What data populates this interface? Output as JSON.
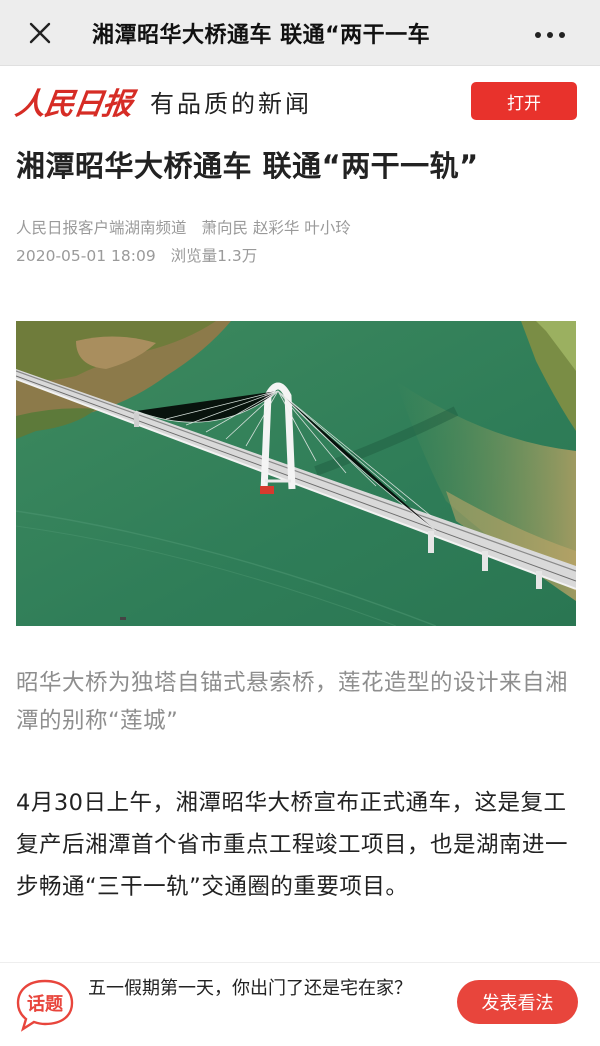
{
  "topbar": {
    "title": "湘潭昭华大桥通车 联通“两干一车",
    "close_icon": "close-icon",
    "more_icon": "more-dots-icon"
  },
  "brand": {
    "logo_text": "人民日报",
    "slogan": "有品质的新闻",
    "open_label": "打开",
    "accent_color": "#e8322c"
  },
  "article": {
    "headline": "湘潭昭华大桥通车 联通“两干一轨”",
    "source": "人民日报客户端湖南频道",
    "authors": "萧向民 赵彩华 叶小玲",
    "datetime": "2020-05-01 18:09",
    "views": "浏览量1.3万",
    "caption": "昭华大桥为独塔自锚式悬索桥，莲花造型的设计来自湘潭的别称“莲城”",
    "paragraph": "4月30日上午，湘潭昭华大桥宣布正式通车，这是复工复产后湘潭首个省市重点工程竣工项目，也是湖南进一步畅通“三干一轨”交通圈的重要项目。"
  },
  "bottom": {
    "topic_icon_text": "话题",
    "question": "五一假期第一天，你出门了还是宅在家？",
    "opinion_label": "发表看法"
  }
}
